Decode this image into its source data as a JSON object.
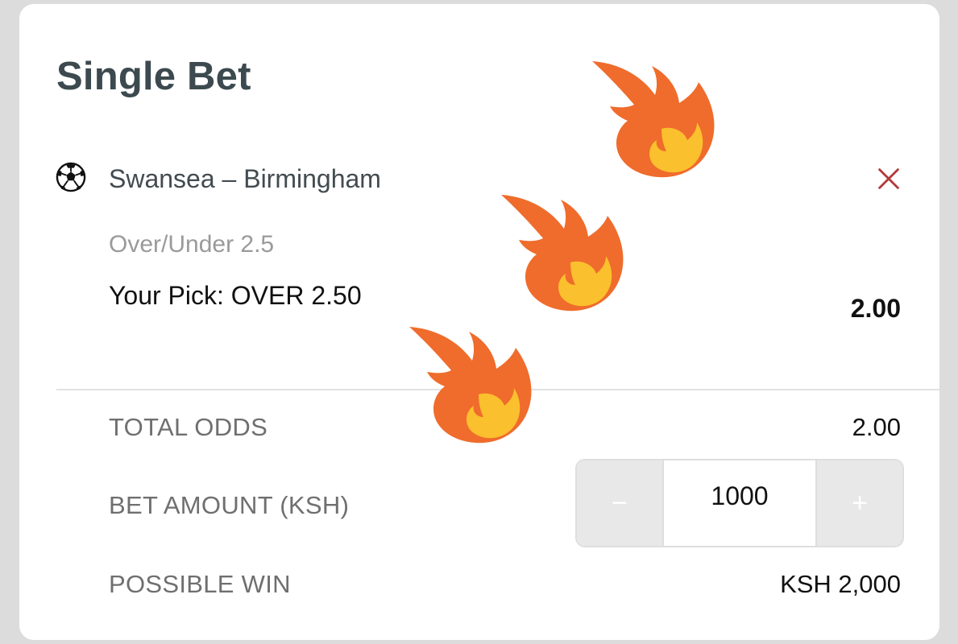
{
  "betslip": {
    "title": "Single Bet",
    "match": "Swansea – Birmingham",
    "market": "Over/Under 2.5",
    "pick": "Your Pick: OVER 2.50",
    "pick_odds": "2.00",
    "sport_icon": "soccer-ball-icon",
    "remove_icon": "close-icon"
  },
  "summary": {
    "total_odds_label": "TOTAL ODDS",
    "total_odds_value": "2.00",
    "bet_amount_label": "BET AMOUNT (KSH)",
    "bet_amount_value": "1000",
    "decrement_label": "−",
    "increment_label": "+",
    "possible_win_label": "POSSIBLE WIN",
    "possible_win_value": "KSH 2,000"
  },
  "decorations": {
    "flame_icon": "fire-emoji-icon",
    "flame_count": 3
  },
  "colors": {
    "title": "#3c4a4f",
    "remove": "#b23a3a",
    "flame_outer": "#ef6c2c",
    "flame_inner": "#fbc02d"
  }
}
